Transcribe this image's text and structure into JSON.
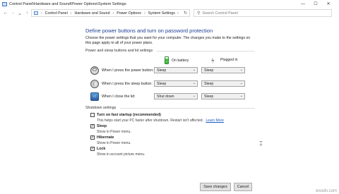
{
  "window": {
    "title": "Control Panel\\Hardware and Sound\\Power Options\\System Settings",
    "controls": {
      "minimize": "—",
      "maximize": "☐",
      "close": "✕"
    }
  },
  "address_bar": {
    "breadcrumbs": [
      "Control Panel",
      "Hardware and Sound",
      "Power Options",
      "System Settings"
    ],
    "search_placeholder": "Search Control Panel"
  },
  "main": {
    "heading": "Define power buttons and turn on password protection",
    "intro": "Choose the power settings that you want for your computer. The changes you make to the settings on this page apply to all of your power plans.",
    "section1_title": "Power and sleep buttons and lid settings",
    "columns": {
      "battery": "On battery",
      "plugged": "Plugged in"
    },
    "rows": [
      {
        "label": "When I press the power button:",
        "battery": "Sleep",
        "plugged": "Sleep"
      },
      {
        "label": "When I press the sleep button:",
        "battery": "Sleep",
        "plugged": "Sleep"
      },
      {
        "label": "When I close the lid:",
        "battery": "Shut down",
        "plugged": "Sleep"
      }
    ],
    "section2_title": "Shutdown settings",
    "shutdown_items": [
      {
        "title": "Turn on fast startup (recommended)",
        "description": "This helps start your PC faster after shutdown. Restart isn't affected.",
        "link": "Learn More",
        "checked": false
      },
      {
        "title": "Sleep",
        "description": "Show in Power menu.",
        "checked": true
      },
      {
        "title": "Hibernate",
        "description": "Show in Power menu.",
        "checked": true
      },
      {
        "title": "Lock",
        "description": "Show in account picture menu.",
        "checked": true
      }
    ]
  },
  "footer": {
    "save": "Save changes",
    "cancel": "Cancel"
  },
  "watermark": "wsxdn.com",
  "colors": {
    "heading": "#1c3f94",
    "link": "#1a5dc4",
    "battery": "#4cc14c"
  }
}
